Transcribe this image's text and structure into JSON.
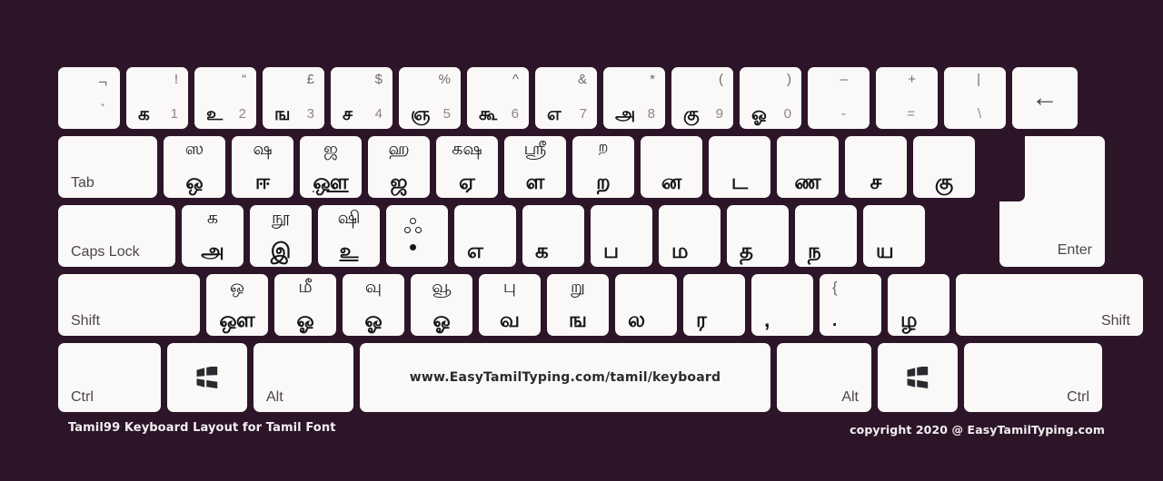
{
  "meta": {
    "background_color": "#2d1529",
    "key_color": "#fbf9f8",
    "glyph_color": "#16161a",
    "modifier_label_color": "#4a4648"
  },
  "footer": {
    "left": "Tamil99 Keyboard Layout for Tamil Font",
    "right": "copyright 2020 @ EasyTamilTyping.com"
  },
  "spacebar": {
    "url": "www.EasyTamilTyping.com/tamil/keyboard"
  },
  "rows": {
    "number": [
      {
        "name": "key-grave",
        "top": "¬",
        "bottom": "`"
      },
      {
        "name": "key-1",
        "top": "!",
        "tamil": "க",
        "digit": "1"
      },
      {
        "name": "key-2",
        "top": "“",
        "tamil": "உ",
        "digit": "2"
      },
      {
        "name": "key-3",
        "top": "£",
        "tamil": "ங",
        "digit": "3"
      },
      {
        "name": "key-4",
        "top": "$",
        "tamil": "ச",
        "digit": "4"
      },
      {
        "name": "key-5",
        "top": "%",
        "tamil": "ஞ",
        "digit": "5"
      },
      {
        "name": "key-6",
        "top": "^",
        "tamil": "கூ",
        "digit": "6"
      },
      {
        "name": "key-7",
        "top": "&",
        "tamil": "எ",
        "digit": "7"
      },
      {
        "name": "key-8",
        "top": "*",
        "tamil": "அ",
        "digit": "8"
      },
      {
        "name": "key-9",
        "top": "(",
        "tamil": "கு",
        "digit": "9"
      },
      {
        "name": "key-0",
        "top": ")",
        "tamil": "ஓ",
        "digit": "0"
      },
      {
        "name": "key-minus",
        "top": "–",
        "bottom": "-"
      },
      {
        "name": "key-equal",
        "top": "+",
        "bottom": "="
      },
      {
        "name": "key-backslash",
        "top": "|",
        "bottom": "\\"
      },
      {
        "name": "key-backspace",
        "icon": "arrow-left-icon",
        "glyph": "←"
      }
    ],
    "tab": [
      {
        "name": "key-tab",
        "label": "Tab"
      },
      {
        "name": "key-q",
        "top": "ஸ",
        "bottom": "ஒ"
      },
      {
        "name": "key-w",
        "top": "ஷ",
        "bottom": "ஈ"
      },
      {
        "name": "key-e",
        "top": "ஜ",
        "bottom": "ஔ",
        "underline": true
      },
      {
        "name": "key-r",
        "top": "ஹ",
        "bottom": "ஜ"
      },
      {
        "name": "key-t",
        "top": "கஷ",
        "bottom": "ஏ"
      },
      {
        "name": "key-y",
        "top": "ஶ்ரீ",
        "bottom": "ள"
      },
      {
        "name": "key-u",
        "top": "ற",
        "bottom": "ற"
      },
      {
        "name": "key-i",
        "single": "ன"
      },
      {
        "name": "key-o",
        "single": "ட"
      },
      {
        "name": "key-p",
        "single": "ண"
      },
      {
        "name": "key-lbracket",
        "single": "ச"
      },
      {
        "name": "key-rbracket",
        "single": "கு"
      }
    ],
    "caps": [
      {
        "name": "key-capslock",
        "label": "Caps Lock"
      },
      {
        "name": "key-a",
        "top": "க௃",
        "bottom": "அ"
      },
      {
        "name": "key-s",
        "top": "நூ",
        "bottom": "இ"
      },
      {
        "name": "key-d",
        "top": "ஷி",
        "bottom": "உ",
        "underline": true
      },
      {
        "name": "key-f",
        "dots": true,
        "top": "ஃ",
        "bottom": "்"
      },
      {
        "name": "key-g",
        "single": "எ"
      },
      {
        "name": "key-h",
        "single": "க"
      },
      {
        "name": "key-j",
        "single": "ப"
      },
      {
        "name": "key-k",
        "single": "ம"
      },
      {
        "name": "key-l",
        "single": "த"
      },
      {
        "name": "key-semicolon",
        "single": "ந"
      },
      {
        "name": "key-quote",
        "single": "ய"
      }
    ],
    "shift": [
      {
        "name": "key-lshift",
        "label": "Shift"
      },
      {
        "name": "key-z",
        "top": "ஒ",
        "bottom": "ஔ"
      },
      {
        "name": "key-x",
        "top": "மீ",
        "bottom": "ஓ"
      },
      {
        "name": "key-c",
        "top": "வு",
        "bottom": "ஓ"
      },
      {
        "name": "key-v",
        "top": "வூ",
        "bottom": "ஓ"
      },
      {
        "name": "key-b",
        "top": "பு",
        "bottom": "வ"
      },
      {
        "name": "key-n",
        "top": "று",
        "bottom": "ங"
      },
      {
        "name": "key-m",
        "single": "ல"
      },
      {
        "name": "key-comma2",
        "single": "ர"
      },
      {
        "name": "key-period-comma",
        "single": ","
      },
      {
        "name": "key-slash",
        "top": "{",
        "bottom": "."
      },
      {
        "name": "key-zha",
        "single": "ழ"
      },
      {
        "name": "key-rshift",
        "label": "Shift"
      }
    ],
    "ctrl": [
      {
        "name": "key-lctrl",
        "label": "Ctrl"
      },
      {
        "name": "key-lwin",
        "icon": "windows-icon"
      },
      {
        "name": "key-lalt",
        "label": "Alt"
      },
      {
        "name": "key-space",
        "url": "www.EasyTamilTyping.com/tamil/keyboard"
      },
      {
        "name": "key-ralt",
        "label": "Alt"
      },
      {
        "name": "key-rwin",
        "icon": "windows-icon"
      },
      {
        "name": "key-rctrl",
        "label": "Ctrl"
      }
    ]
  },
  "enter": {
    "label": "Enter"
  }
}
